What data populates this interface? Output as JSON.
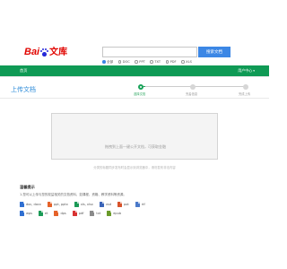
{
  "header": {
    "logo_text": "Bai",
    "logo_suffix": "文库",
    "search_placeholder": "",
    "search_button": "搜索文档",
    "filters": [
      {
        "label": "全部",
        "selected": true
      },
      {
        "label": "DOC",
        "selected": false
      },
      {
        "label": "PPT",
        "selected": false
      },
      {
        "label": "TXT",
        "selected": false
      },
      {
        "label": "PDF",
        "selected": false
      },
      {
        "label": "XLS",
        "selected": false
      }
    ]
  },
  "nav": {
    "home": "首页",
    "user": "用户中心"
  },
  "upload": {
    "title": "上传文档",
    "steps": [
      {
        "label": "选择文档",
        "active": true
      },
      {
        "label": "完善信息",
        "active": false
      },
      {
        "label": "完成上传",
        "active": false
      }
    ],
    "dropzone_text": "拖拽到上面一键公开文档，可获取金融",
    "drop_note": "分类的标题同步发布时会显示到浏览器中，请勿发布非法内容"
  },
  "tips": {
    "title": "温馨提示",
    "line1": "1.您可以上传与您的权益相关的文档资料，如课程、资格、教学资料等资源。",
    "types": [
      [
        {
          "label": "doc, docx",
          "color": "#2f6fd1"
        },
        {
          "label": "ppt, pptx",
          "color": "#e5622a"
        },
        {
          "label": "xls, xlsx",
          "color": "#1b9a56"
        },
        {
          "label": "vsd",
          "color": "#3a64b8"
        },
        {
          "label": "pot",
          "color": "#d7532b"
        },
        {
          "label": "rtf",
          "color": "#4a79c9"
        }
      ],
      [
        {
          "label": "wps",
          "color": "#2f6fd1"
        },
        {
          "label": "et",
          "color": "#1b9a56"
        },
        {
          "label": "dps",
          "color": "#e5622a"
        },
        {
          "label": "pdf",
          "color": "#d83232"
        },
        {
          "label": "txt",
          "color": "#8a8a8a"
        },
        {
          "label": "epub",
          "color": "#6a9a2a"
        }
      ]
    ]
  },
  "colors": {
    "nav_green": "#0f9a55",
    "accent_blue": "#3c87e5",
    "title_blue": "#2f8cd9",
    "step_green": "#19a35a"
  }
}
